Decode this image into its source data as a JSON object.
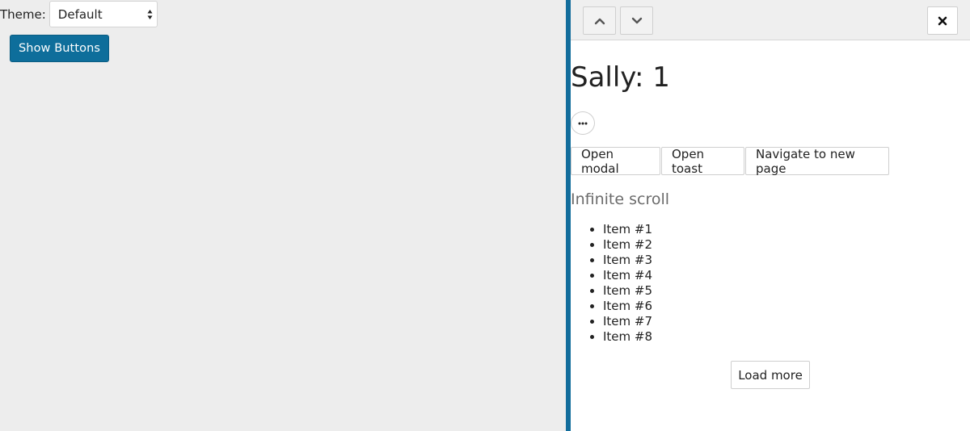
{
  "theme": {
    "label": "Theme:",
    "selected": "Default"
  },
  "controls": {
    "show_buttons_label": "Show Buttons"
  },
  "panel": {
    "toolbar": {
      "up_icon": "chevron-up-icon",
      "down_icon": "chevron-down-icon",
      "close_icon": "close-icon"
    },
    "title": "Sally: 1",
    "more_icon": "ellipsis-icon",
    "actions": [
      {
        "label": "Open modal"
      },
      {
        "label": "Open toast"
      },
      {
        "label": "Navigate to new page"
      }
    ],
    "section_title": "Infinite scroll",
    "items": [
      "Item #1",
      "Item #2",
      "Item #3",
      "Item #4",
      "Item #5",
      "Item #6",
      "Item #7",
      "Item #8"
    ],
    "load_more_label": "Load more"
  },
  "colors": {
    "accent": "#0e6e9b",
    "panel_border": "#126d9c",
    "background": "#ededed"
  }
}
